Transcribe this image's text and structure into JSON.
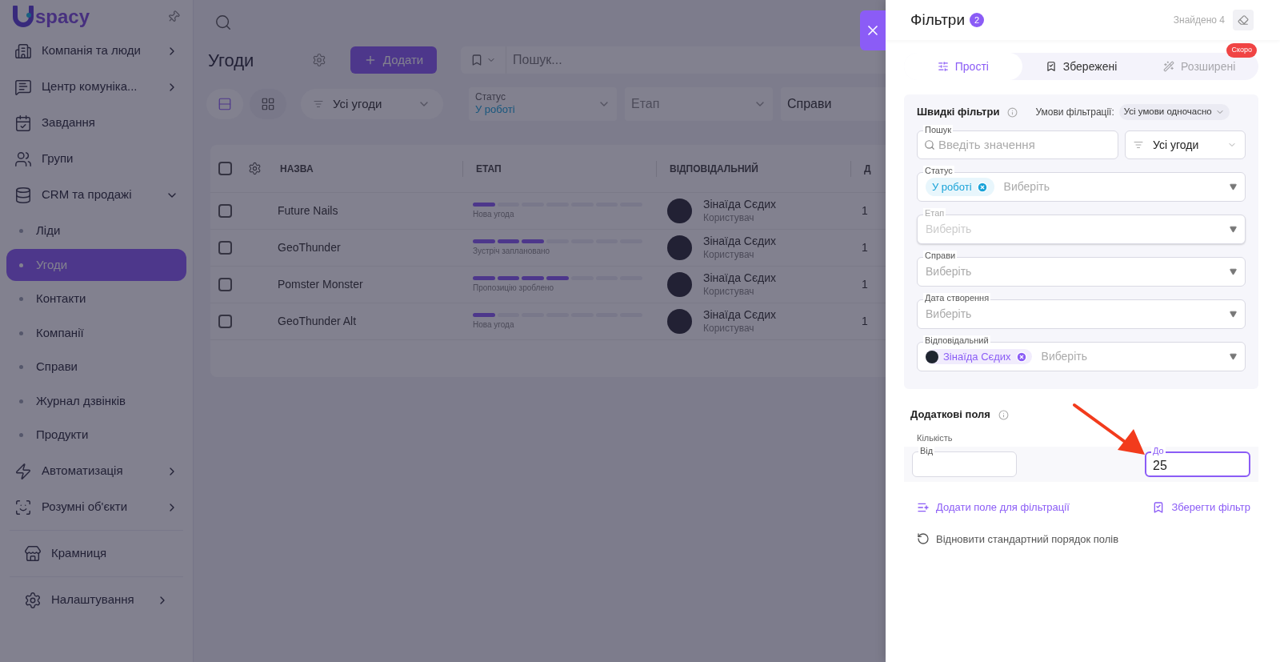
{
  "sidebar": {
    "logo_text": "spacy",
    "sections": [
      [
        {
          "label": "Компанія та люди",
          "expanded": false
        },
        {
          "label": "Центр комуніка...",
          "expanded": false
        },
        {
          "label": "Завдання"
        },
        {
          "label": "Групи"
        },
        {
          "label": "CRM та продажі",
          "expanded": true,
          "children": [
            {
              "label": "Ліди",
              "selected": false
            },
            {
              "label": "Угоди",
              "selected": true
            },
            {
              "label": "Контакти",
              "selected": false
            },
            {
              "label": "Компанії",
              "selected": false
            },
            {
              "label": "Справи",
              "selected": false
            },
            {
              "label": "Журнал дзвінків",
              "selected": false
            },
            {
              "label": "Продукти",
              "selected": false
            }
          ]
        },
        {
          "label": "Автоматизація",
          "expanded": false
        },
        {
          "label": "Розумні об'єкти",
          "expanded": false
        }
      ],
      [
        {
          "label": "Крамниця"
        }
      ],
      [
        {
          "label": "Налаштування",
          "expanded": false
        }
      ]
    ]
  },
  "page": {
    "title": "Угоди",
    "add_button": "Додати",
    "search": {
      "placeholder": "Пошук..."
    },
    "views": [
      {
        "kind": "list",
        "selected": true
      },
      {
        "kind": "grid",
        "selected": false
      }
    ],
    "deal_filter": "Усі угоди",
    "filters": [
      {
        "label": "Статус",
        "value": "У роботі"
      },
      {
        "placeholder": "Етап"
      },
      {
        "value": "Справи"
      }
    ]
  },
  "table": {
    "all_checked": false,
    "columns": [
      "НАЗВА",
      "ЕТАП",
      "ВІДПОВІДАЛЬНИЙ",
      "Д"
    ],
    "rows": [
      {
        "checked": false,
        "name": "Future Nails",
        "stage": {
          "level": 0.143,
          "label": "Нова угода"
        },
        "owner": "Зінаїда Сєдих",
        "role": "Користувач",
        "column_4": "1"
      },
      {
        "checked": false,
        "name": "GeoThunder",
        "stage": {
          "level": 0.429,
          "label": "Зустріч заплановано"
        },
        "owner": "Зінаїда Сєдих",
        "role": "Користувач",
        "column_4": "1"
      },
      {
        "checked": false,
        "name": "Pomster Monster",
        "stage": {
          "level": 0.571,
          "label": "Пропозицію зроблено"
        },
        "owner": "Зінаїда Сєдих",
        "role": "Користувач",
        "column_4": "1"
      },
      {
        "checked": false,
        "name": "GeoThunder Alt",
        "stage": {
          "level": 0.143,
          "label": "Нова угода"
        },
        "owner": "Зінаїда Сєдих",
        "role": "Користувач",
        "column_4": "1"
      }
    ]
  },
  "panel": {
    "title": "Фільтри",
    "count": "2",
    "found": "Знайдено 4",
    "tabs": [
      {
        "label": "Прості",
        "selected": true,
        "disabled": false
      },
      {
        "label": "Збережені",
        "selected": false,
        "disabled": false
      },
      {
        "label": "Розширені",
        "selected": false,
        "disabled": true,
        "badge": "Скоро"
      }
    ],
    "quick": {
      "title": "Швидкі фільтри",
      "condition_label": "Умови фільтрації:",
      "condition_value": "Усі умови одночасно",
      "search": {
        "label": "Пошук",
        "placeholder": "Введіть значення"
      },
      "deal_select": "Усі угоди",
      "fields": [
        {
          "label": "Статус",
          "disabled": false,
          "chips": [
            {
              "kind": "status",
              "text": "У роботі"
            }
          ],
          "placeholder": "Виберіть"
        },
        {
          "label": "Етап",
          "disabled": true,
          "placeholder": "Виберіть"
        },
        {
          "label": "Справи",
          "disabled": false,
          "placeholder": "Виберіть"
        },
        {
          "label": "Дата створення",
          "disabled": false,
          "placeholder": "Виберіть"
        },
        {
          "label": "Відповідальний",
          "disabled": false,
          "chips": [
            {
              "kind": "user",
              "text": "Зінаїда Сєдих"
            }
          ],
          "placeholder": "Виберіть"
        }
      ]
    },
    "extra": {
      "title": "Додаткові поля",
      "group_label": "Кількість",
      "from": {
        "label": "Від",
        "focused": false
      },
      "to": {
        "label": "До",
        "value": "25",
        "focused": true
      }
    },
    "actions": {
      "add_field": "Додати поле для фільтрації",
      "save": "Зберегти фільтр",
      "reset": "Відновити стандартний порядок полів"
    }
  }
}
